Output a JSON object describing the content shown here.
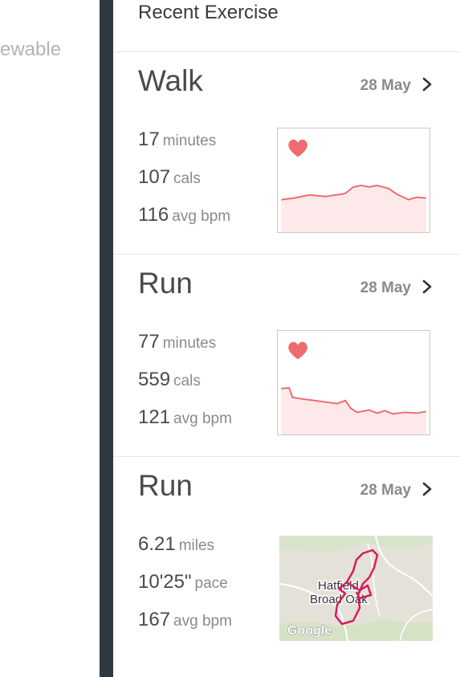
{
  "background_fragment": "ewable",
  "panel": {
    "title": "Recent Exercise"
  },
  "exercises": [
    {
      "name": "Walk",
      "date": "28 May",
      "stats": [
        {
          "value": "17",
          "unit": "minutes"
        },
        {
          "value": "107",
          "unit": "cals"
        },
        {
          "value": "116",
          "unit": "avg bpm"
        }
      ],
      "visual": "heart-rate-graph"
    },
    {
      "name": "Run",
      "date": "28 May",
      "stats": [
        {
          "value": "77",
          "unit": "minutes"
        },
        {
          "value": "559",
          "unit": "cals"
        },
        {
          "value": "121",
          "unit": "avg bpm"
        }
      ],
      "visual": "heart-rate-graph"
    },
    {
      "name": "Run",
      "date": "28 May",
      "stats": [
        {
          "value": "6.21",
          "unit": "miles"
        },
        {
          "value": "10'25\"",
          "unit": "pace"
        },
        {
          "value": "167",
          "unit": "avg bpm"
        }
      ],
      "visual": "route-map",
      "map": {
        "place_line1": "Hatfield",
        "place_line2": "Broad Oak",
        "attribution": "Google"
      }
    }
  ],
  "colors": {
    "accent": "#ef6b6e",
    "fill": "#fde9ea",
    "route": "#d81b60",
    "divider": "#2e3940"
  },
  "icons": {
    "heart": "heart-icon",
    "chevron": "chevron-right-icon"
  }
}
